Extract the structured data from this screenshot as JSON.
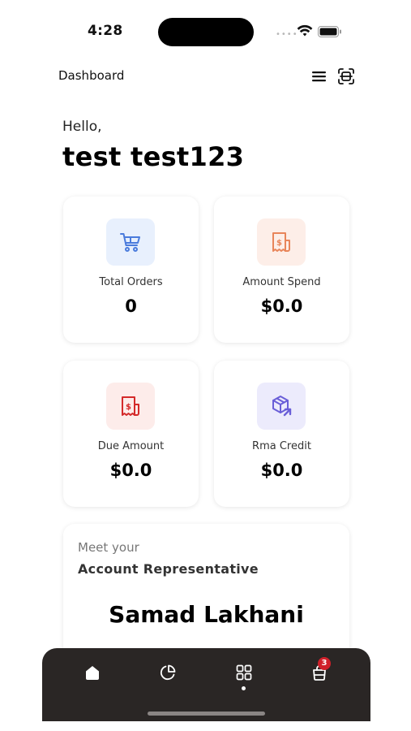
{
  "status_bar": {
    "time": "4:28"
  },
  "header": {
    "title": "Dashboard"
  },
  "greeting": {
    "hello": "Hello,",
    "name": "test test123"
  },
  "cards": [
    {
      "label": "Total Orders",
      "value": "0",
      "icon": "cart-icon",
      "icon_bg": "#e8f0fd",
      "icon_color": "#4a7bdc"
    },
    {
      "label": "Amount Spend",
      "value": "$0.0",
      "icon": "receipt-icon",
      "icon_bg": "#fdeee8",
      "icon_color": "#e8855a"
    },
    {
      "label": "Due Amount",
      "value": "$0.0",
      "icon": "due-receipt-icon",
      "icon_bg": "#fdecea",
      "icon_color": "#d42a2a"
    },
    {
      "label": "Rma Credit",
      "value": "$0.0",
      "icon": "package-return-icon",
      "icon_bg": "#ecebfc",
      "icon_color": "#6a5fd8"
    }
  ],
  "representative": {
    "intro": "Meet your",
    "title": "Account Representative",
    "name": "Samad Lakhani"
  },
  "bottom_nav": {
    "items": [
      "home-icon",
      "pie-chart-icon",
      "grid-icon",
      "cart-bag-icon"
    ],
    "active_index": 2,
    "cart_badge": "3",
    "background": "#2a2625"
  }
}
